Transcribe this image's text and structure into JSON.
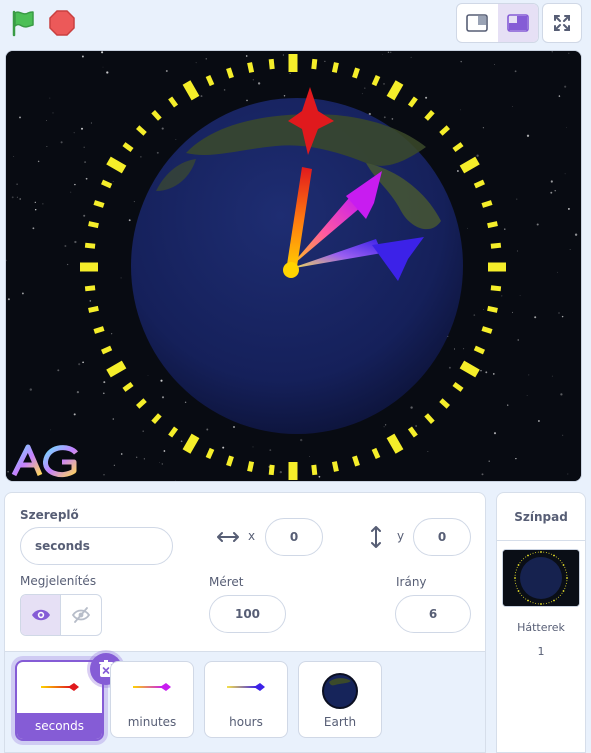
{
  "toolbar": {
    "green_flag_icon": "green-flag-icon",
    "stop_icon": "stop-icon",
    "small_stage_icon": "small-stage-icon",
    "normal_stage_icon": "normal-stage-icon",
    "fullscreen_icon": "fullscreen-icon"
  },
  "stage": {
    "logo_text": "AG"
  },
  "sprite_info": {
    "sprite_label": "Szereplő",
    "sprite_name": "seconds",
    "x_label": "x",
    "x_value": "0",
    "y_label": "y",
    "y_value": "0",
    "show_label": "Megjelenítés",
    "size_label": "Méret",
    "size_value": "100",
    "direction_label": "Irány",
    "direction_value": "6"
  },
  "sprites": [
    {
      "name": "seconds",
      "selected": true,
      "color": "#e0191d"
    },
    {
      "name": "minutes",
      "selected": false,
      "color": "#c81cf0"
    },
    {
      "name": "hours",
      "selected": false,
      "color": "#3c22e8"
    },
    {
      "name": "Earth",
      "selected": false,
      "color": "#16245a"
    }
  ],
  "stage_panel": {
    "title": "Színpad",
    "backdrops_label": "Hátterek",
    "backdrops_count": "1"
  },
  "colors": {
    "accent": "#855cd6",
    "flag_green": "#4cbf56",
    "stop_red": "#ec5959",
    "tick_yellow": "#f5ee2a"
  }
}
